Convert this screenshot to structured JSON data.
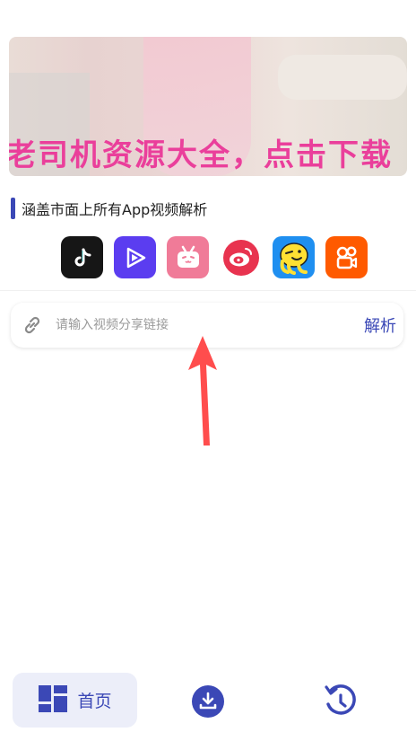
{
  "banner": {
    "text": "老司机资源大全，点击下载"
  },
  "section": {
    "title": "涵盖市面上所有App视频解析"
  },
  "apps": [
    {
      "icon": "tiktok-icon",
      "color": "#161616"
    },
    {
      "icon": "video-play-icon",
      "color": "#5b3df0"
    },
    {
      "icon": "bilibili-icon",
      "color": "#f07b98"
    },
    {
      "icon": "weibo-icon",
      "color": "#e8334f"
    },
    {
      "icon": "pipixia-icon",
      "color": "#1f8ff0"
    },
    {
      "icon": "kuaishou-icon",
      "color": "#ff5a00"
    }
  ],
  "input": {
    "placeholder": "请输入视频分享链接",
    "value": "",
    "action_label": "解析"
  },
  "tabbar": {
    "home_label": "首页",
    "accent": "#3b48b6"
  }
}
